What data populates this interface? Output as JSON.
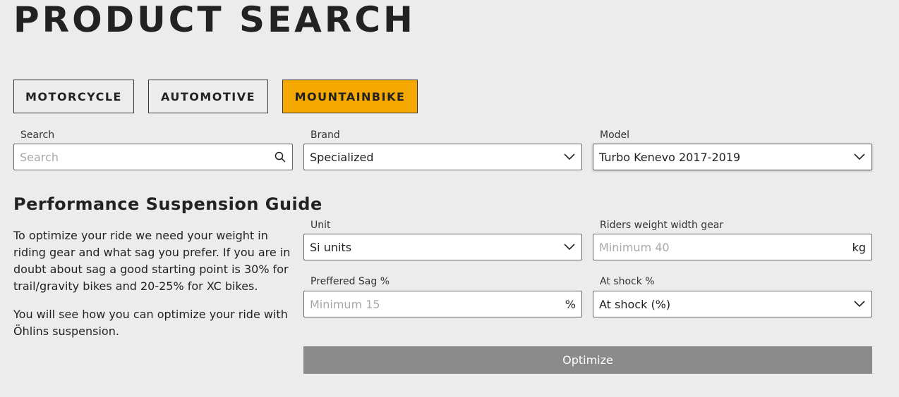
{
  "page": {
    "title": "PRODUCT SEARCH"
  },
  "tabs": [
    {
      "label": "MOTORCYCLE",
      "active": false
    },
    {
      "label": "AUTOMOTIVE",
      "active": false
    },
    {
      "label": "MOUNTAINBIKE",
      "active": true
    }
  ],
  "search": {
    "label": "Search",
    "placeholder": "Search",
    "icon": "search-icon"
  },
  "brand": {
    "label": "Brand",
    "value": "Specialized"
  },
  "model": {
    "label": "Model",
    "value": "Turbo Kenevo 2017-2019"
  },
  "guide": {
    "title": "Performance Suspension Guide",
    "paragraph1": "To optimize your ride we need your weight in riding gear and what sag you prefer. If you are in doubt about sag a good starting point is 30% for trail/gravity bikes and 20-25% for XC bikes.",
    "paragraph2": "You will see how you can optimize your ride with Öhlins suspension."
  },
  "unit": {
    "label": "Unit",
    "value": "Si units"
  },
  "weight": {
    "label": "Riders weight width gear",
    "placeholder": "Minimum 40",
    "suffix": "kg"
  },
  "sag": {
    "label": "Preffered Sag %",
    "placeholder": "Minimum 15",
    "suffix": "%"
  },
  "shock": {
    "label": "At shock %",
    "value": "At shock (%)"
  },
  "optimize": {
    "label": "Optimize"
  },
  "colors": {
    "accent": "#f5a800",
    "button_disabled": "#8a8a8a",
    "background": "#ececec"
  }
}
